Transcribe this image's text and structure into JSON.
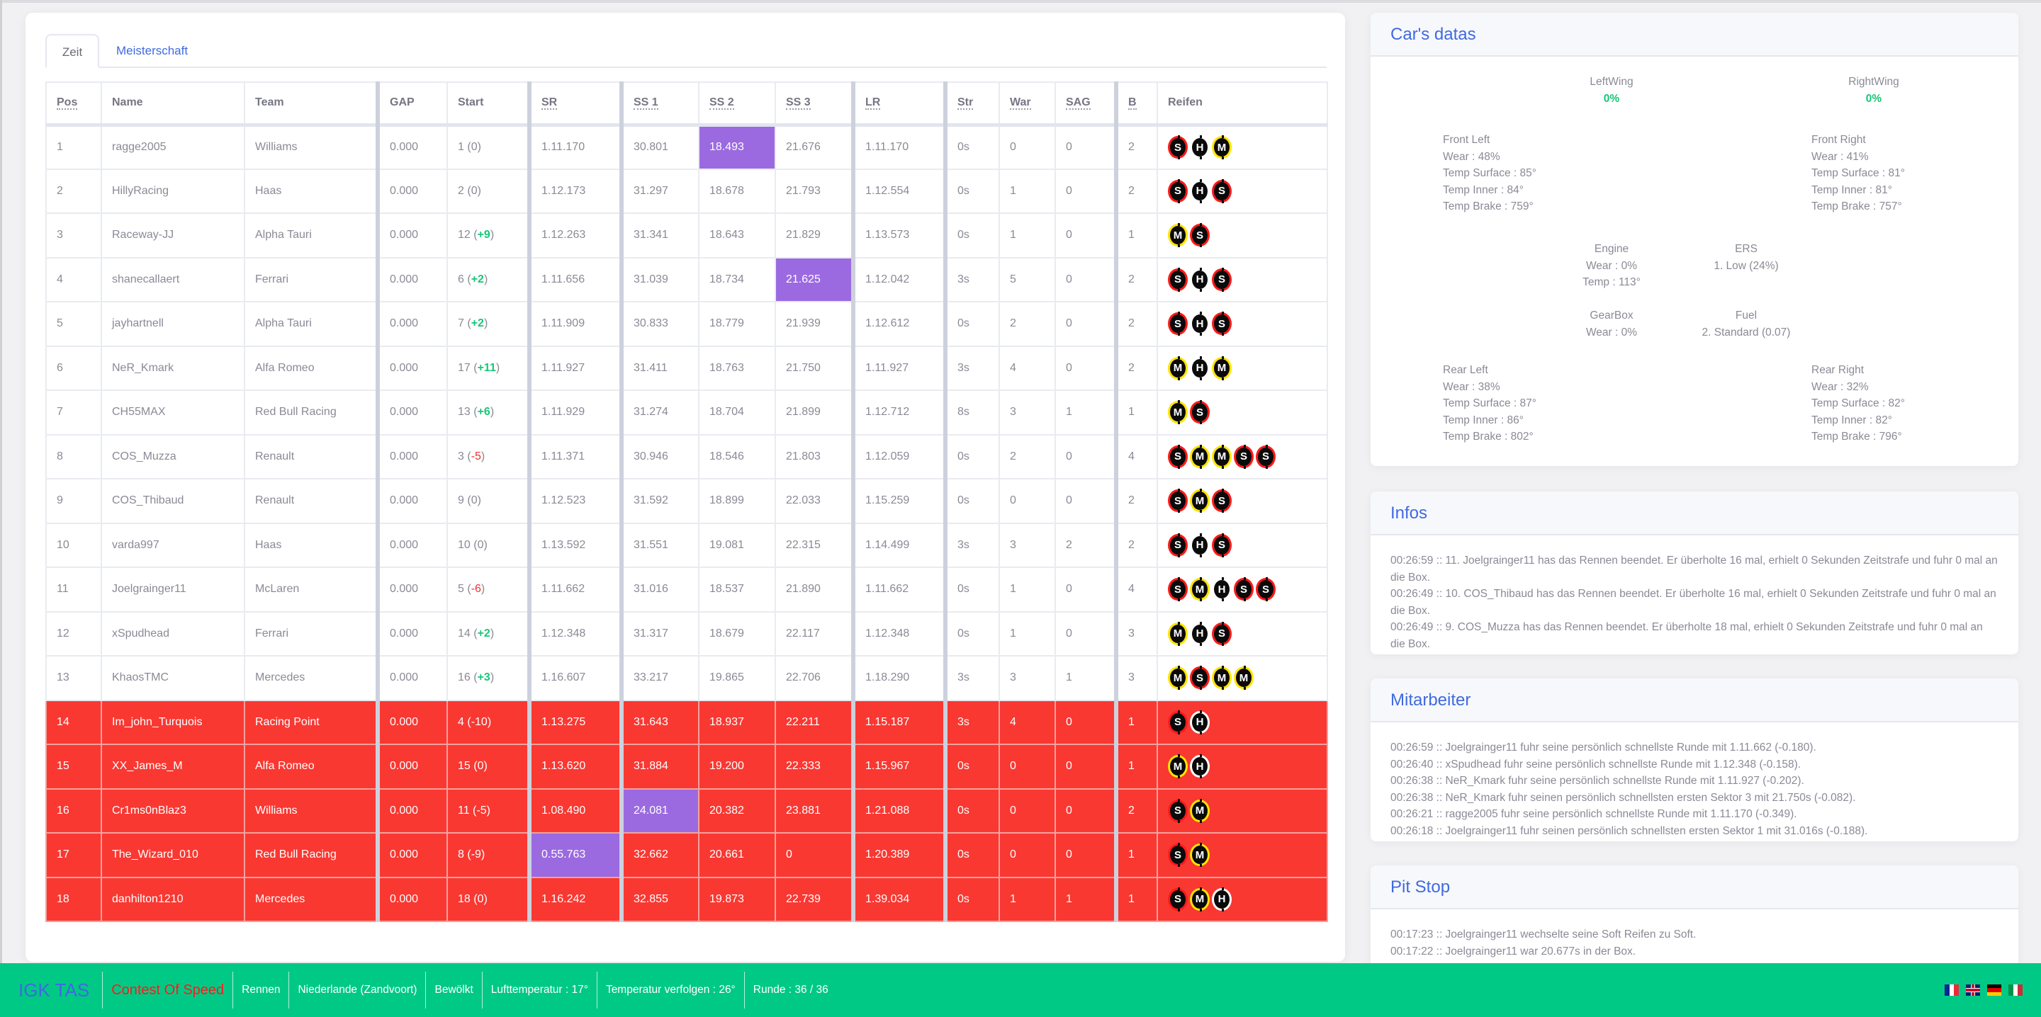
{
  "tabs": [
    {
      "label": "Zeit",
      "active": true
    },
    {
      "label": "Meisterschaft",
      "active": false
    }
  ],
  "table": {
    "columns": [
      "Pos",
      "Name",
      "Team",
      "GAP",
      "Start",
      "SR",
      "SS 1",
      "SS 2",
      "SS 3",
      "LR",
      "Str",
      "War",
      "SAG",
      "B",
      "Reifen"
    ],
    "rows": [
      {
        "pos": "1",
        "name": "ragge2005",
        "team": "Williams",
        "gap": "0.000",
        "start": "1",
        "delta": "0",
        "delta_dir": "none",
        "sr": "1.11.170",
        "ss1": "30.801",
        "ss2": "18.493",
        "ss3": "21.676",
        "lr": "1.11.170",
        "str": "0s",
        "war": "0",
        "sag": "0",
        "b": "2",
        "tyres": [
          "S",
          "H",
          "M"
        ],
        "purple": [
          "ss2"
        ],
        "dnf": false
      },
      {
        "pos": "2",
        "name": "HillyRacing",
        "team": "Haas",
        "gap": "0.000",
        "start": "2",
        "delta": "0",
        "delta_dir": "none",
        "sr": "1.12.173",
        "ss1": "31.297",
        "ss2": "18.678",
        "ss3": "21.793",
        "lr": "1.12.554",
        "str": "0s",
        "war": "1",
        "sag": "0",
        "b": "2",
        "tyres": [
          "S",
          "H",
          "S"
        ],
        "purple": [],
        "dnf": false
      },
      {
        "pos": "3",
        "name": "Raceway-JJ",
        "team": "Alpha Tauri",
        "gap": "0.000",
        "start": "12",
        "delta": "+9",
        "delta_dir": "up",
        "sr": "1.12.263",
        "ss1": "31.341",
        "ss2": "18.643",
        "ss3": "21.829",
        "lr": "1.13.573",
        "str": "0s",
        "war": "1",
        "sag": "0",
        "b": "1",
        "tyres": [
          "M",
          "S"
        ],
        "purple": [],
        "dnf": false
      },
      {
        "pos": "4",
        "name": "shanecallaert",
        "team": "Ferrari",
        "gap": "0.000",
        "start": "6",
        "delta": "+2",
        "delta_dir": "up",
        "sr": "1.11.656",
        "ss1": "31.039",
        "ss2": "18.734",
        "ss3": "21.625",
        "lr": "1.12.042",
        "str": "3s",
        "war": "5",
        "sag": "0",
        "b": "2",
        "tyres": [
          "S",
          "H",
          "S"
        ],
        "purple": [
          "ss3"
        ],
        "dnf": false
      },
      {
        "pos": "5",
        "name": "jayhartnell",
        "team": "Alpha Tauri",
        "gap": "0.000",
        "start": "7",
        "delta": "+2",
        "delta_dir": "up",
        "sr": "1.11.909",
        "ss1": "30.833",
        "ss2": "18.779",
        "ss3": "21.939",
        "lr": "1.12.612",
        "str": "0s",
        "war": "2",
        "sag": "0",
        "b": "2",
        "tyres": [
          "S",
          "H",
          "S"
        ],
        "purple": [],
        "dnf": false
      },
      {
        "pos": "6",
        "name": "NeR_Kmark",
        "team": "Alfa Romeo",
        "gap": "0.000",
        "start": "17",
        "delta": "+11",
        "delta_dir": "up",
        "sr": "1.11.927",
        "ss1": "31.411",
        "ss2": "18.763",
        "ss3": "21.750",
        "lr": "1.11.927",
        "str": "3s",
        "war": "4",
        "sag": "0",
        "b": "2",
        "tyres": [
          "M",
          "H",
          "M"
        ],
        "purple": [],
        "dnf": false
      },
      {
        "pos": "7",
        "name": "CH55MAX",
        "team": "Red Bull Racing",
        "gap": "0.000",
        "start": "13",
        "delta": "+6",
        "delta_dir": "up",
        "sr": "1.11.929",
        "ss1": "31.274",
        "ss2": "18.704",
        "ss3": "21.899",
        "lr": "1.12.712",
        "str": "8s",
        "war": "3",
        "sag": "1",
        "b": "1",
        "tyres": [
          "M",
          "S"
        ],
        "purple": [],
        "dnf": false
      },
      {
        "pos": "8",
        "name": "COS_Muzza",
        "team": "Renault",
        "gap": "0.000",
        "start": "3",
        "delta": "-5",
        "delta_dir": "down",
        "sr": "1.11.371",
        "ss1": "30.946",
        "ss2": "18.546",
        "ss3": "21.803",
        "lr": "1.12.059",
        "str": "0s",
        "war": "2",
        "sag": "0",
        "b": "4",
        "tyres": [
          "S",
          "M",
          "M",
          "S",
          "S"
        ],
        "purple": [],
        "dnf": false
      },
      {
        "pos": "9",
        "name": "COS_Thibaud",
        "team": "Renault",
        "gap": "0.000",
        "start": "9",
        "delta": "0",
        "delta_dir": "none",
        "sr": "1.12.523",
        "ss1": "31.592",
        "ss2": "18.899",
        "ss3": "22.033",
        "lr": "1.15.259",
        "str": "0s",
        "war": "0",
        "sag": "0",
        "b": "2",
        "tyres": [
          "S",
          "M",
          "S"
        ],
        "purple": [],
        "dnf": false
      },
      {
        "pos": "10",
        "name": "varda997",
        "team": "Haas",
        "gap": "0.000",
        "start": "10",
        "delta": "0",
        "delta_dir": "none",
        "sr": "1.13.592",
        "ss1": "31.551",
        "ss2": "19.081",
        "ss3": "22.315",
        "lr": "1.14.499",
        "str": "3s",
        "war": "3",
        "sag": "2",
        "b": "2",
        "tyres": [
          "S",
          "H",
          "S"
        ],
        "purple": [],
        "dnf": false
      },
      {
        "pos": "11",
        "name": "Joelgrainger11",
        "team": "McLaren",
        "gap": "0.000",
        "start": "5",
        "delta": "-6",
        "delta_dir": "down",
        "sr": "1.11.662",
        "ss1": "31.016",
        "ss2": "18.537",
        "ss3": "21.890",
        "lr": "1.11.662",
        "str": "0s",
        "war": "1",
        "sag": "0",
        "b": "4",
        "tyres": [
          "S",
          "M",
          "H",
          "S",
          "S"
        ],
        "purple": [],
        "dnf": false
      },
      {
        "pos": "12",
        "name": "xSpudhead",
        "team": "Ferrari",
        "gap": "0.000",
        "start": "14",
        "delta": "+2",
        "delta_dir": "up",
        "sr": "1.12.348",
        "ss1": "31.317",
        "ss2": "18.679",
        "ss3": "22.117",
        "lr": "1.12.348",
        "str": "0s",
        "war": "1",
        "sag": "0",
        "b": "3",
        "tyres": [
          "M",
          "H",
          "S"
        ],
        "purple": [],
        "dnf": false
      },
      {
        "pos": "13",
        "name": "KhaosTMC",
        "team": "Mercedes",
        "gap": "0.000",
        "start": "16",
        "delta": "+3",
        "delta_dir": "up",
        "sr": "1.16.607",
        "ss1": "33.217",
        "ss2": "19.865",
        "ss3": "22.706",
        "lr": "1.18.290",
        "str": "3s",
        "war": "3",
        "sag": "1",
        "b": "3",
        "tyres": [
          "M",
          "S",
          "M",
          "M"
        ],
        "purple": [],
        "dnf": false
      },
      {
        "pos": "14",
        "name": "Im_john_Turquois",
        "team": "Racing Point",
        "gap": "0.000",
        "start": "4",
        "delta": "-10",
        "delta_dir": "down",
        "sr": "1.13.275",
        "ss1": "31.643",
        "ss2": "18.937",
        "ss3": "22.211",
        "lr": "1.15.187",
        "str": "3s",
        "war": "4",
        "sag": "0",
        "b": "1",
        "tyres": [
          "S",
          "H"
        ],
        "purple": [],
        "dnf": true
      },
      {
        "pos": "15",
        "name": "XX_James_M",
        "team": "Alfa Romeo",
        "gap": "0.000",
        "start": "15",
        "delta": "0",
        "delta_dir": "none",
        "sr": "1.13.620",
        "ss1": "31.884",
        "ss2": "19.200",
        "ss3": "22.333",
        "lr": "1.15.967",
        "str": "0s",
        "war": "0",
        "sag": "0",
        "b": "1",
        "tyres": [
          "M",
          "H"
        ],
        "purple": [],
        "dnf": true
      },
      {
        "pos": "16",
        "name": "Cr1ms0nBlaz3",
        "team": "Williams",
        "gap": "0.000",
        "start": "11",
        "delta": "-5",
        "delta_dir": "down",
        "sr": "1.08.490",
        "ss1": "24.081",
        "ss2": "20.382",
        "ss3": "23.881",
        "lr": "1.21.088",
        "str": "0s",
        "war": "0",
        "sag": "0",
        "b": "2",
        "tyres": [
          "S",
          "M"
        ],
        "purple": [
          "ss1"
        ],
        "dnf": true
      },
      {
        "pos": "17",
        "name": "The_Wizard_010",
        "team": "Red Bull Racing",
        "gap": "0.000",
        "start": "8",
        "delta": "-9",
        "delta_dir": "down",
        "sr": "0.55.763",
        "ss1": "32.662",
        "ss2": "20.661",
        "ss3": "0",
        "lr": "1.20.389",
        "str": "0s",
        "war": "0",
        "sag": "0",
        "b": "1",
        "tyres": [
          "S",
          "M"
        ],
        "purple": [
          "sr"
        ],
        "dnf": true
      },
      {
        "pos": "18",
        "name": "danhilton1210",
        "team": "Mercedes",
        "gap": "0.000",
        "start": "18",
        "delta": "0",
        "delta_dir": "none",
        "sr": "1.16.242",
        "ss1": "32.855",
        "ss2": "19.873",
        "ss3": "22.739",
        "lr": "1.39.034",
        "str": "0s",
        "war": "1",
        "sag": "1",
        "b": "1",
        "tyres": [
          "S",
          "M",
          "H"
        ],
        "purple": [],
        "dnf": true
      }
    ]
  },
  "colors": {
    "accent": "#3f6ae0",
    "purple_best": "#9b6ae0",
    "dnf_row": "#f93832",
    "footer_bg": "#00c985",
    "gain": "#17c777",
    "loss": "#f0312c",
    "tyre_soft": "#ff1a1a",
    "tyre_medium": "#ffe500",
    "tyre_hard": "#ffffff"
  },
  "cars": {
    "title": "Car's datas",
    "left_wing": {
      "label": "LeftWing",
      "value": "0%"
    },
    "right_wing": {
      "label": "RightWing",
      "value": "0%"
    },
    "front_left": {
      "label": "Front Left",
      "wear": "Wear : 48%",
      "surface": "Temp Surface : 85°",
      "inner": "Temp Inner : 84°",
      "brake": "Temp Brake : 759°"
    },
    "front_right": {
      "label": "Front Right",
      "wear": "Wear : 41%",
      "surface": "Temp Surface : 81°",
      "inner": "Temp Inner : 81°",
      "brake": "Temp Brake : 757°"
    },
    "engine": {
      "label": "Engine",
      "wear": "Wear : 0%",
      "temp": "Temp : 113°"
    },
    "ers": {
      "label": "ERS",
      "value": "1. Low (24%)"
    },
    "gearbox": {
      "label": "GearBox",
      "wear": "Wear : 0%"
    },
    "fuel": {
      "label": "Fuel",
      "value": "2. Standard (0.07)"
    },
    "rear_left": {
      "label": "Rear Left",
      "wear": "Wear : 38%",
      "surface": "Temp Surface : 87°",
      "inner": "Temp Inner : 86°",
      "brake": "Temp Brake : 802°"
    },
    "rear_right": {
      "label": "Rear Right",
      "wear": "Wear : 32%",
      "surface": "Temp Surface : 82°",
      "inner": "Temp Inner : 82°",
      "brake": "Temp Brake : 796°"
    }
  },
  "infos": {
    "title": "Infos",
    "lines": [
      "00:26:59 :: 11. Joelgrainger11 has das Rennen beendet. Er überholte 16 mal, erhielt 0 Sekunden Zeitstrafe und fuhr 0 mal an die Box.",
      "00:26:49 :: 10. COS_Thibaud has das Rennen beendet. Er überholte 16 mal, erhielt 0 Sekunden Zeitstrafe und fuhr 0 mal an die Box.",
      "00:26:49 :: 9. COS_Muzza has das Rennen beendet. Er überholte 18 mal, erhielt 0 Sekunden Zeitstrafe und fuhr 0 mal an die Box."
    ]
  },
  "mitarbeiter": {
    "title": "Mitarbeiter",
    "lines": [
      "00:26:59 :: Joelgrainger11 fuhr seine persönlich schnellste Runde mit 1.11.662 (-0.180).",
      "00:26:40 :: xSpudhead fuhr seine persönlich schnellste Runde mit 1.12.348 (-0.158).",
      "00:26:38 :: NeR_Kmark fuhr seine persönlich schnellste Runde mit 1.11.927 (-0.202).",
      "00:26:38 :: NeR_Kmark fuhr seinen persönlich schnellsten ersten Sektor 3 mit 21.750s (-0.082).",
      "00:26:21 :: ragge2005 fuhr seine persönlich schnellste Runde mit 1.11.170 (-0.349).",
      "00:26:18 :: Joelgrainger11 fuhr seinen persönlich schnellsten ersten Sektor 1 mit 31.016s (-0.188)."
    ]
  },
  "pitstop": {
    "title": "Pit Stop",
    "lines": [
      "00:17:23 :: Joelgrainger11 wechselte seine Soft Reifen zu Soft.",
      "00:17:22 :: Joelgrainger11 war 20.677s in der Box."
    ]
  },
  "footer": {
    "brand": "IGK TAS",
    "contest": "Contest Of Speed",
    "session": "Rennen",
    "track": "Niederlande (Zandvoort)",
    "weather": "Bewölkt",
    "air_temp": "Lufttemperatur : 17°",
    "track_temp": "Temperatur verfolgen : 26°",
    "lap": "Runde : 36 / 36",
    "languages": [
      "fr-flag-icon",
      "uk-flag-icon",
      "de-flag-icon",
      "it-flag-icon"
    ]
  }
}
